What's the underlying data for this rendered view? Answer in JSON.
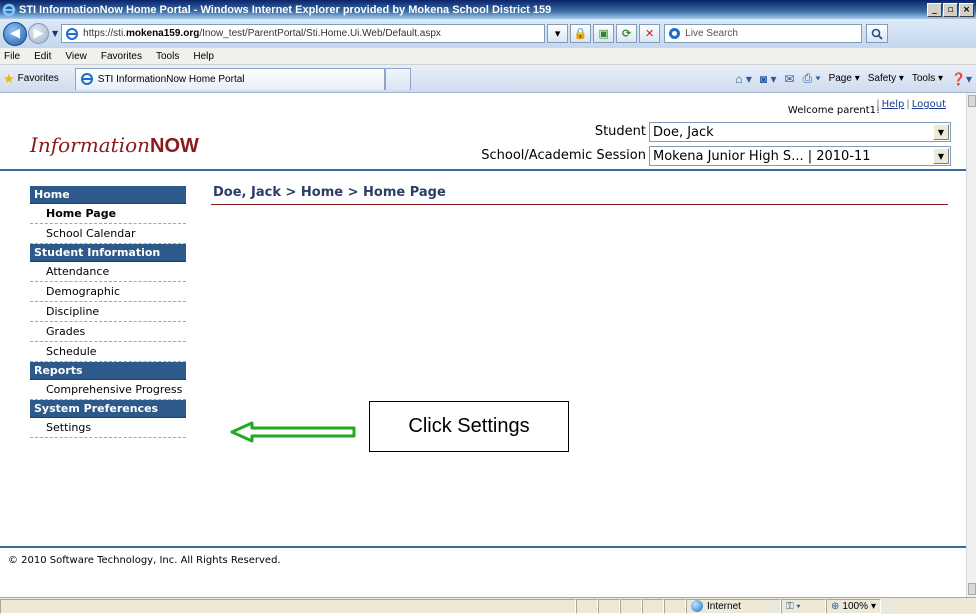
{
  "window": {
    "title": "STI InformationNow Home Portal - Windows Internet Explorer provided by Mokena School District 159",
    "minimize": "_",
    "maximize": "▫",
    "close": "×"
  },
  "address": {
    "url_prefix": "https://sti.",
    "url_domain": "mokena159.org",
    "url_path": "/Inow_test/ParentPortal/Sti.Home.Ui.Web/Default.aspx",
    "search_placeholder": "Live Search"
  },
  "menu": [
    "File",
    "Edit",
    "View",
    "Favorites",
    "Tools",
    "Help"
  ],
  "favbar": {
    "favorites": "Favorites",
    "tab_title": "STI InformationNow Home Portal",
    "page_label": "Page ▾",
    "safety_label": "Safety ▾",
    "tools_label": "Tools ▾"
  },
  "header": {
    "logo_italic": "Information",
    "logo_bold": "NOW",
    "welcome": "Welcome parent1!",
    "help": "Help",
    "logout": "Logout",
    "student_label": "Student",
    "student_value": "Doe, Jack",
    "session_label": "School/Academic Session",
    "session_value": "Mokena Junior High S... | 2010-11"
  },
  "sidebar": {
    "sections": [
      {
        "title": "Home",
        "items": [
          {
            "label": "Home Page",
            "active": true
          },
          {
            "label": "School Calendar"
          }
        ]
      },
      {
        "title": "Student Information",
        "items": [
          {
            "label": "Attendance"
          },
          {
            "label": "Demographic"
          },
          {
            "label": "Discipline"
          },
          {
            "label": "Grades"
          },
          {
            "label": "Schedule"
          }
        ]
      },
      {
        "title": "Reports",
        "items": [
          {
            "label": "Comprehensive Progress"
          }
        ]
      },
      {
        "title": "System Preferences",
        "items": [
          {
            "label": "Settings"
          }
        ]
      }
    ]
  },
  "main": {
    "breadcrumb": "Doe, Jack > Home > Home Page"
  },
  "annotation": {
    "callout": "Click Settings",
    "arrow_color": "#22aa22"
  },
  "footer": {
    "copyright": "© 2010 Software Technology, Inc. All Rights Reserved."
  },
  "status": {
    "zone": "Internet",
    "zoom": "100%"
  }
}
